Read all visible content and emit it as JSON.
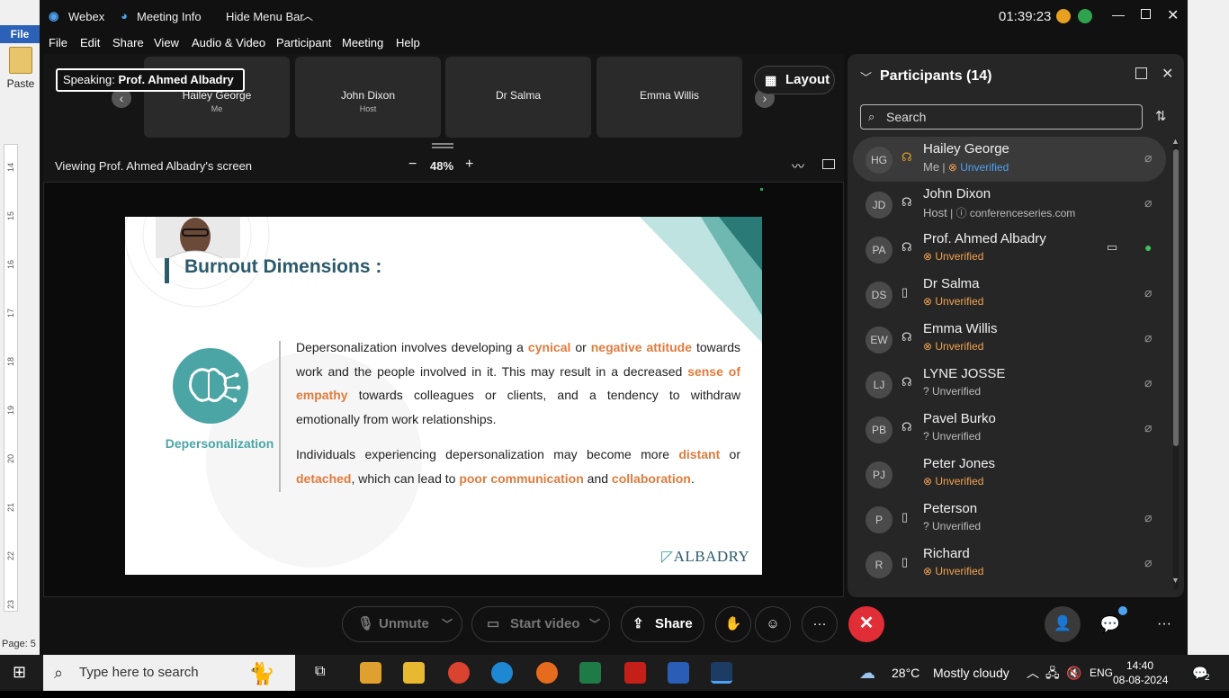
{
  "word": {
    "file_tab": "File",
    "paste_label": "Paste",
    "page_status": "Page: 5",
    "ruler_marks": [
      "14",
      "15",
      "16",
      "17",
      "18",
      "19",
      "20",
      "21",
      "22",
      "23"
    ]
  },
  "titlebar": {
    "app_name": "Webex",
    "meeting_info": "Meeting Info",
    "hide_menu": "Hide Menu Bar",
    "timer": "01:39:23"
  },
  "menu": [
    "File",
    "Edit",
    "Share",
    "View",
    "Audio & Video",
    "Participant",
    "Meeting",
    "Help"
  ],
  "stage": {
    "speaking_prefix": "Speaking:",
    "speaking_name": "Prof. Ahmed Albadry",
    "thumbnails": [
      {
        "name": "Hailey George",
        "role": "Me"
      },
      {
        "name": "John Dixon",
        "role": "Host"
      },
      {
        "name": "Dr Salma",
        "role": ""
      },
      {
        "name": "Emma Willis",
        "role": ""
      }
    ],
    "layout_label": "Layout",
    "viewing_label": "Viewing Prof. Ahmed Albadry's screen",
    "zoom": "48%",
    "zoom_minus": "−",
    "zoom_plus": "+"
  },
  "slide": {
    "title": "Burnout Dimensions :",
    "icon_label": "Depersonalization",
    "p1": [
      {
        "t": "Depersonalization involves developing a ",
        "h": false
      },
      {
        "t": "cynical",
        "h": true
      },
      {
        "t": " or ",
        "h": false
      },
      {
        "t": "negative attitude",
        "h": true
      },
      {
        "t": " towards work and the people involved in it. This may result in a decreased ",
        "h": false
      },
      {
        "t": "sense of empathy",
        "h": true
      },
      {
        "t": " towards colleagues or clients, and a tendency to withdraw emotionally from work relationships.",
        "h": false
      }
    ],
    "p2": [
      {
        "t": "Individuals experiencing depersonalization may become more ",
        "h": false
      },
      {
        "t": "distant",
        "h": true
      },
      {
        "t": " or ",
        "h": false
      },
      {
        "t": "detached",
        "h": true
      },
      {
        "t": ", which can lead to ",
        "h": false
      },
      {
        "t": "poor communication",
        "h": true
      },
      {
        "t": " and ",
        "h": false
      },
      {
        "t": "collaboration",
        "h": true
      },
      {
        "t": ".",
        "h": false
      }
    ],
    "logo": "ALBADRY",
    "highlight_color": "#e07b3d",
    "accent_color": "#4ba5a5"
  },
  "controls": {
    "unmute": "Unmute",
    "start_video": "Start video",
    "share": "Share",
    "more": "···"
  },
  "panel": {
    "title": "Participants (14)",
    "search_placeholder": "Search",
    "participants": [
      {
        "initials": "HG",
        "name": "Hailey George",
        "role": "Me",
        "status": "Unverified",
        "status_kind": "good",
        "device": "headset",
        "mic": "muted",
        "selected": true
      },
      {
        "initials": "JD",
        "name": "John Dixon",
        "role": "Host",
        "status": "conferenceseries.com",
        "status_kind": "info",
        "device": "headset",
        "mic": "muted",
        "selected": false
      },
      {
        "initials": "PA",
        "name": "Prof. Ahmed Albadry",
        "role": "",
        "status": "Unverified",
        "status_kind": "bad",
        "device": "headset",
        "mic": "on",
        "camera": true,
        "selected": false
      },
      {
        "initials": "DS",
        "name": "Dr Salma",
        "role": "",
        "status": "Unverified",
        "status_kind": "bad",
        "device": "phone",
        "mic": "muted",
        "selected": false
      },
      {
        "initials": "EW",
        "name": "Emma Willis",
        "role": "",
        "status": "Unverified",
        "status_kind": "bad",
        "device": "headset",
        "mic": "muted",
        "selected": false
      },
      {
        "initials": "LJ",
        "name": "LYNE JOSSE",
        "role": "",
        "status": "Unverified",
        "status_kind": "unknown",
        "device": "headset",
        "mic": "muted",
        "selected": false
      },
      {
        "initials": "PB",
        "name": "Pavel Burko",
        "role": "",
        "status": "Unverified",
        "status_kind": "unknown",
        "device": "headset",
        "mic": "muted",
        "selected": false
      },
      {
        "initials": "PJ",
        "name": "Peter Jones",
        "role": "",
        "status": "Unverified",
        "status_kind": "bad",
        "device": "none",
        "mic": "none",
        "selected": false
      },
      {
        "initials": "P",
        "name": "Peterson",
        "role": "",
        "status": "Unverified",
        "status_kind": "unknown",
        "device": "phone",
        "mic": "muted",
        "selected": false
      },
      {
        "initials": "R",
        "name": "Richard",
        "role": "",
        "status": "Unverified",
        "status_kind": "bad",
        "device": "phone",
        "mic": "muted",
        "selected": false
      }
    ]
  },
  "taskbar": {
    "search_placeholder": "Type here to search",
    "weather_temp": "28°C",
    "weather_desc": "Mostly cloudy",
    "lang": "ENG",
    "time": "14:40",
    "date": "08-08-2024",
    "notif_count": "2"
  }
}
